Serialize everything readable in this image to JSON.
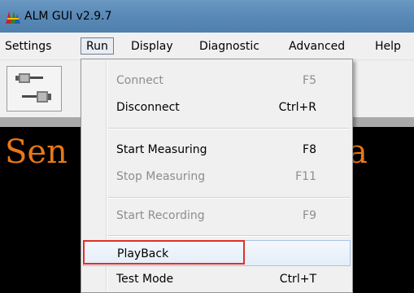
{
  "window": {
    "title": "ALM GUI v2.9.7",
    "icon": "alm-app-icon"
  },
  "menubar": {
    "items": [
      {
        "label": "Settings"
      },
      {
        "label": "Run"
      },
      {
        "label": "Display"
      },
      {
        "label": "Diagnostic"
      },
      {
        "label": "Advanced"
      },
      {
        "label": "Help"
      }
    ],
    "open_item": "Run"
  },
  "toolbar": {
    "buttons": [
      {
        "icon": "connect-plug-icon"
      }
    ]
  },
  "panel": {
    "text_left": "Sen",
    "text_right": "a",
    "text_color": "#e87717"
  },
  "run_menu": {
    "items": [
      {
        "label": "Connect",
        "shortcut": "F5",
        "enabled": false
      },
      {
        "label": "Disconnect",
        "shortcut": "Ctrl+R",
        "enabled": true
      },
      {
        "label": "Start Measuring",
        "shortcut": "F8",
        "enabled": true
      },
      {
        "label": "Stop Measuring",
        "shortcut": "F11",
        "enabled": false
      },
      {
        "label": "Start Recording",
        "shortcut": "F9",
        "enabled": false
      },
      {
        "label": "PlayBack",
        "shortcut": "",
        "enabled": true,
        "hovered": true,
        "highlighted": true
      },
      {
        "label": "Test Mode",
        "shortcut": "Ctrl+T",
        "enabled": true
      }
    ]
  },
  "colors": {
    "titlebar": "#5b8ab8",
    "highlight_box": "#e0302a"
  }
}
